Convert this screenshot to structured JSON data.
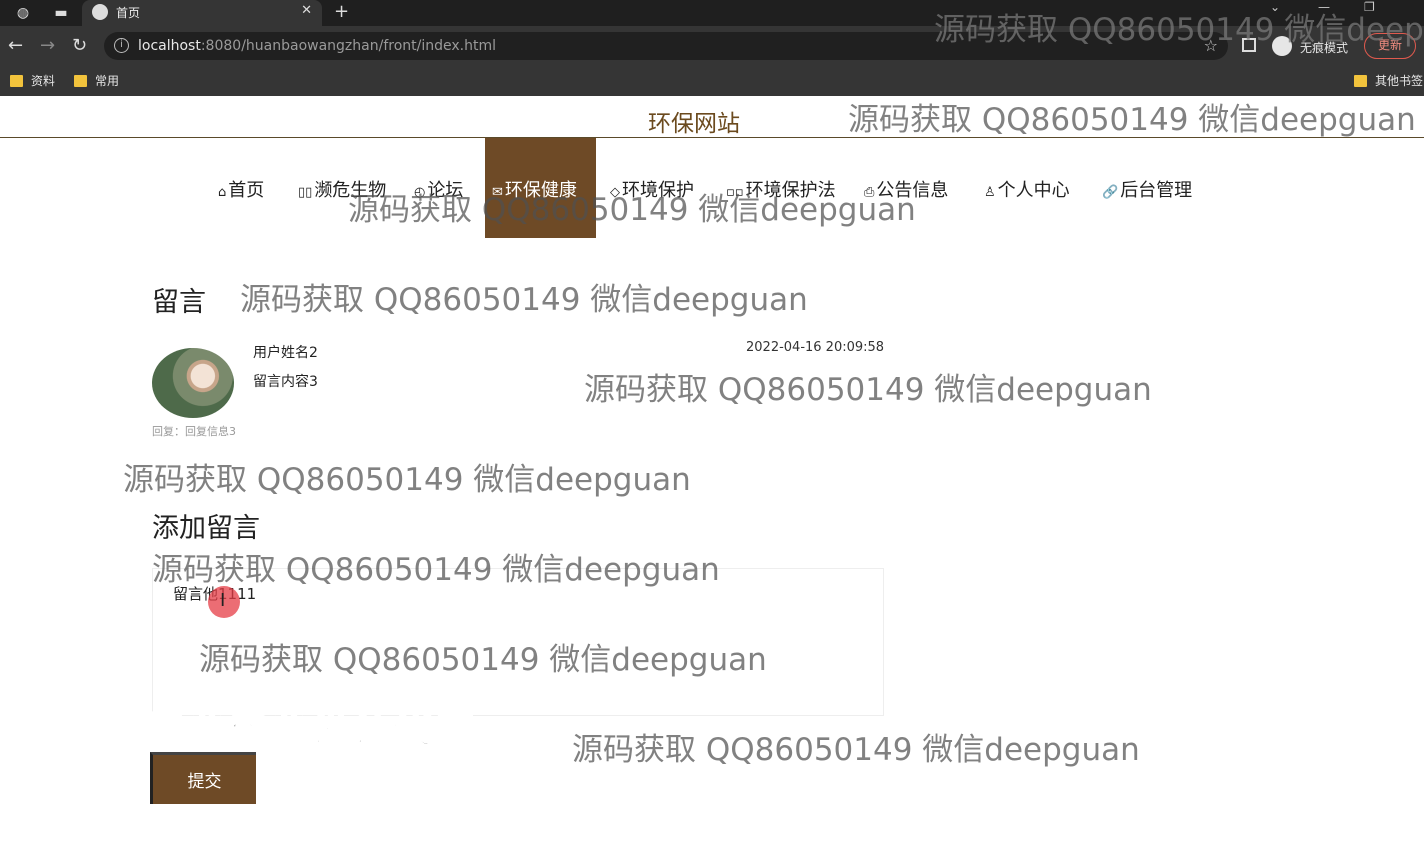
{
  "browser": {
    "tab_title": "首页",
    "url_host": "localhost",
    "url_rest": ":8080/huanbaowangzhan/front/index.html",
    "incognito_label": "无痕模式",
    "update_label": "更新",
    "bookmarks": [
      "资料",
      "常用",
      "其他书签"
    ]
  },
  "site": {
    "title": "环保网站",
    "nav": [
      {
        "icon": "⌂",
        "label": "首页"
      },
      {
        "icon": "▯▯",
        "label": "濒危生物"
      },
      {
        "icon": "◴",
        "label": "论坛"
      },
      {
        "icon": "✉",
        "label": "环保健康"
      },
      {
        "icon": "◇",
        "label": "环境保护"
      },
      {
        "icon": "▫▫",
        "label": "环境保护法"
      },
      {
        "icon": "⎙",
        "label": "公告信息"
      },
      {
        "icon": "♙",
        "label": "个人中心"
      },
      {
        "icon": "🔗",
        "label": "后台管理"
      }
    ],
    "active_nav": "环保健康"
  },
  "messages": {
    "title": "留言",
    "items": [
      {
        "user": "用户姓名2",
        "content": "留言内容3",
        "time": "2022-04-16 20:09:58",
        "reply": "回复：回复信息3"
      }
    ]
  },
  "add_message": {
    "title": "添加留言",
    "value": "留言他1111",
    "submit_label": "提交"
  },
  "watermark": {
    "text": "源码获取 QQ86050149 微信deepguan",
    "top_text": "源码获取 QQ86050149 微信deepgu",
    "banner": "专业毕业设计代做"
  },
  "colors": {
    "accent": "#6e4a26",
    "title": "#6b4a1e"
  }
}
